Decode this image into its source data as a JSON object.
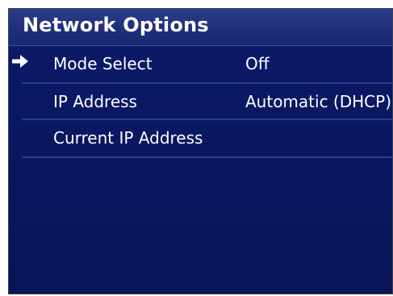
{
  "header": {
    "title": "Network Options"
  },
  "menu": {
    "items": [
      {
        "label": "Mode Select",
        "value": "Off",
        "selected": true
      },
      {
        "label": "IP Address",
        "value": "Automatic (DHCP)",
        "selected": false
      },
      {
        "label": "Current IP Address",
        "value": "",
        "selected": false
      }
    ]
  },
  "icons": {
    "selection_cursor": "right-arrow-icon"
  },
  "colors": {
    "background": "#0c1a6a",
    "header": "#1f2f79",
    "text": "#ffffff"
  }
}
